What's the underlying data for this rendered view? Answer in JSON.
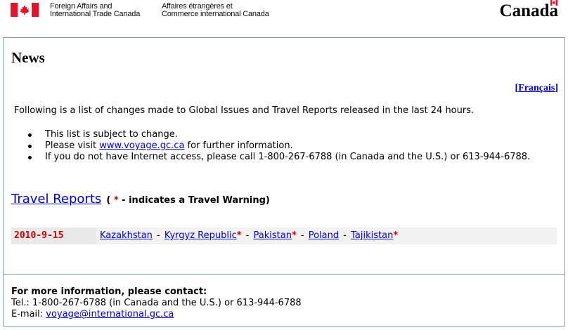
{
  "header": {
    "dept_en_line1": "Foreign Affairs and",
    "dept_en_line2": "International Trade Canada",
    "dept_fr_line1": "Affaires étrangères et",
    "dept_fr_line2": "Commerce international Canada",
    "wordmark": "Canada",
    "flag_color": "#e8112d"
  },
  "page": {
    "title": "News",
    "language_link": "Français",
    "intro": "Following is a list of changes made to Global Issues and Travel Reports released in the last 24 hours."
  },
  "bullets": {
    "item1": "This list is subject to change.",
    "item2_pre": "Please visit ",
    "item2_link": "www.voyage.gc.ca",
    "item2_post": " for further information.",
    "item3": "If you do not have Internet access, please call 1-800-267-6788 (in Canada and the U.S.) or 613-944-6788."
  },
  "travel_reports": {
    "heading_link": "Travel Reports",
    "note_open": "( ",
    "note_star": "*",
    "note_text": " - indicates a Travel Warning)",
    "rows": [
      {
        "date": "2010-9-15",
        "countries": [
          {
            "name": "Kazakhstan",
            "warning": false
          },
          {
            "name": "Kyrgyz Republic",
            "warning": true
          },
          {
            "name": "Pakistan",
            "warning": true
          },
          {
            "name": "Poland",
            "warning": false
          },
          {
            "name": "Tajikistan",
            "warning": true
          }
        ]
      }
    ],
    "separator": "-",
    "warning_mark": "*",
    "date_color": "#cc0000",
    "warning_color": "#cc0000"
  },
  "contact": {
    "heading": "For more information, please contact:",
    "tel": "Tel.: 1-800-267-6788 (in Canada and the U.S.) or 613-944-6788",
    "email_label": "E-mail: ",
    "email_link": "voyage@international.gc.ca"
  }
}
